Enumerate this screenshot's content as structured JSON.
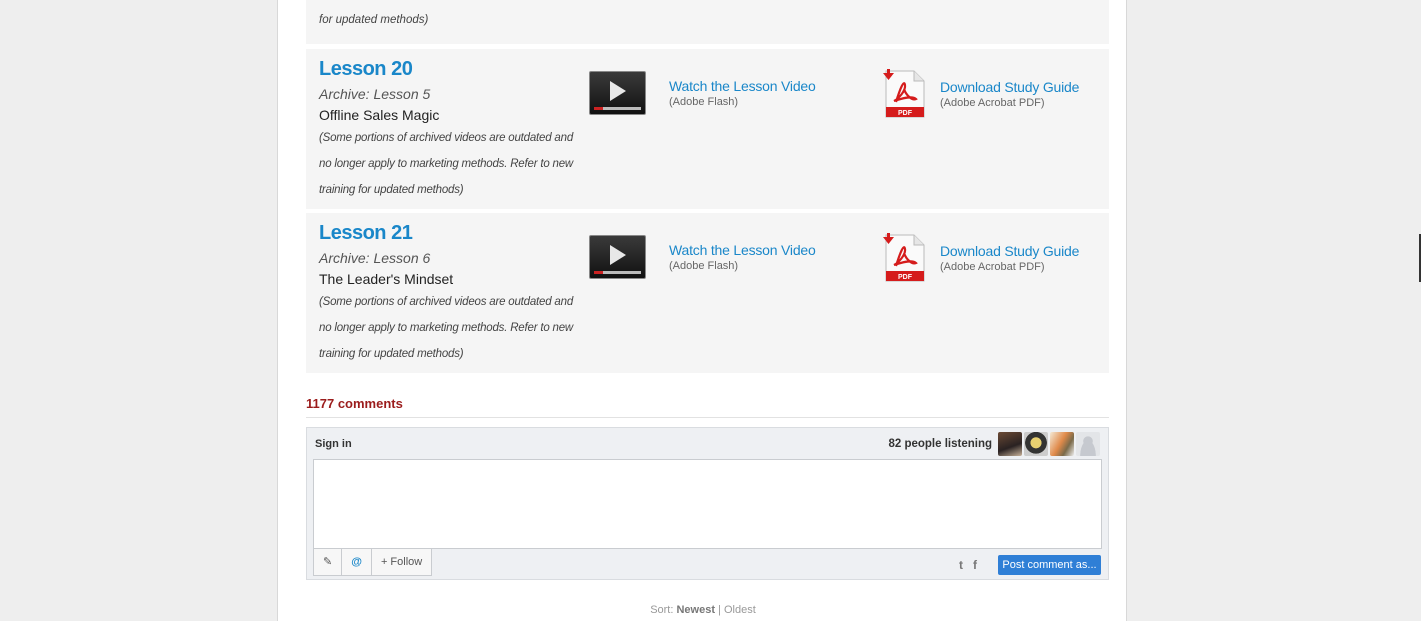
{
  "top_lesson": {
    "note_fragment": "for updated methods)"
  },
  "lessons": [
    {
      "title": "Lesson 20",
      "archive": "Archive: Lesson 5",
      "subtitle": "Offline Sales Magic",
      "note": "(Some portions of archived videos are outdated and no longer apply to marketing methods. Refer to new training for updated methods)",
      "video_link": "Watch the Lesson Video",
      "video_format": "(Adobe Flash)",
      "guide_link": "Download Study Guide",
      "guide_format": "(Adobe Acrobat PDF)"
    },
    {
      "title": "Lesson 21",
      "archive": "Archive: Lesson 6",
      "subtitle": "The Leader's Mindset",
      "note": "(Some portions of archived videos are outdated and no longer apply to marketing methods. Refer to new training for updated methods)",
      "video_link": "Watch the Lesson Video",
      "video_format": "(Adobe Flash)",
      "guide_link": "Download Study Guide",
      "guide_format": "(Adobe Acrobat PDF)"
    }
  ],
  "comments": {
    "count_label": "1177 comments",
    "sign_in": "Sign in",
    "listening": "82 people listening",
    "follow": "+ Follow",
    "post_button": "Post comment as...",
    "sort_label": "Sort:",
    "sort_newest": "Newest",
    "sort_separator": "|",
    "sort_oldest": "Oldest"
  },
  "colors": {
    "link": "#1a87c9",
    "comments_count": "#9b1c1c",
    "post_button": "#2f7fd6"
  }
}
